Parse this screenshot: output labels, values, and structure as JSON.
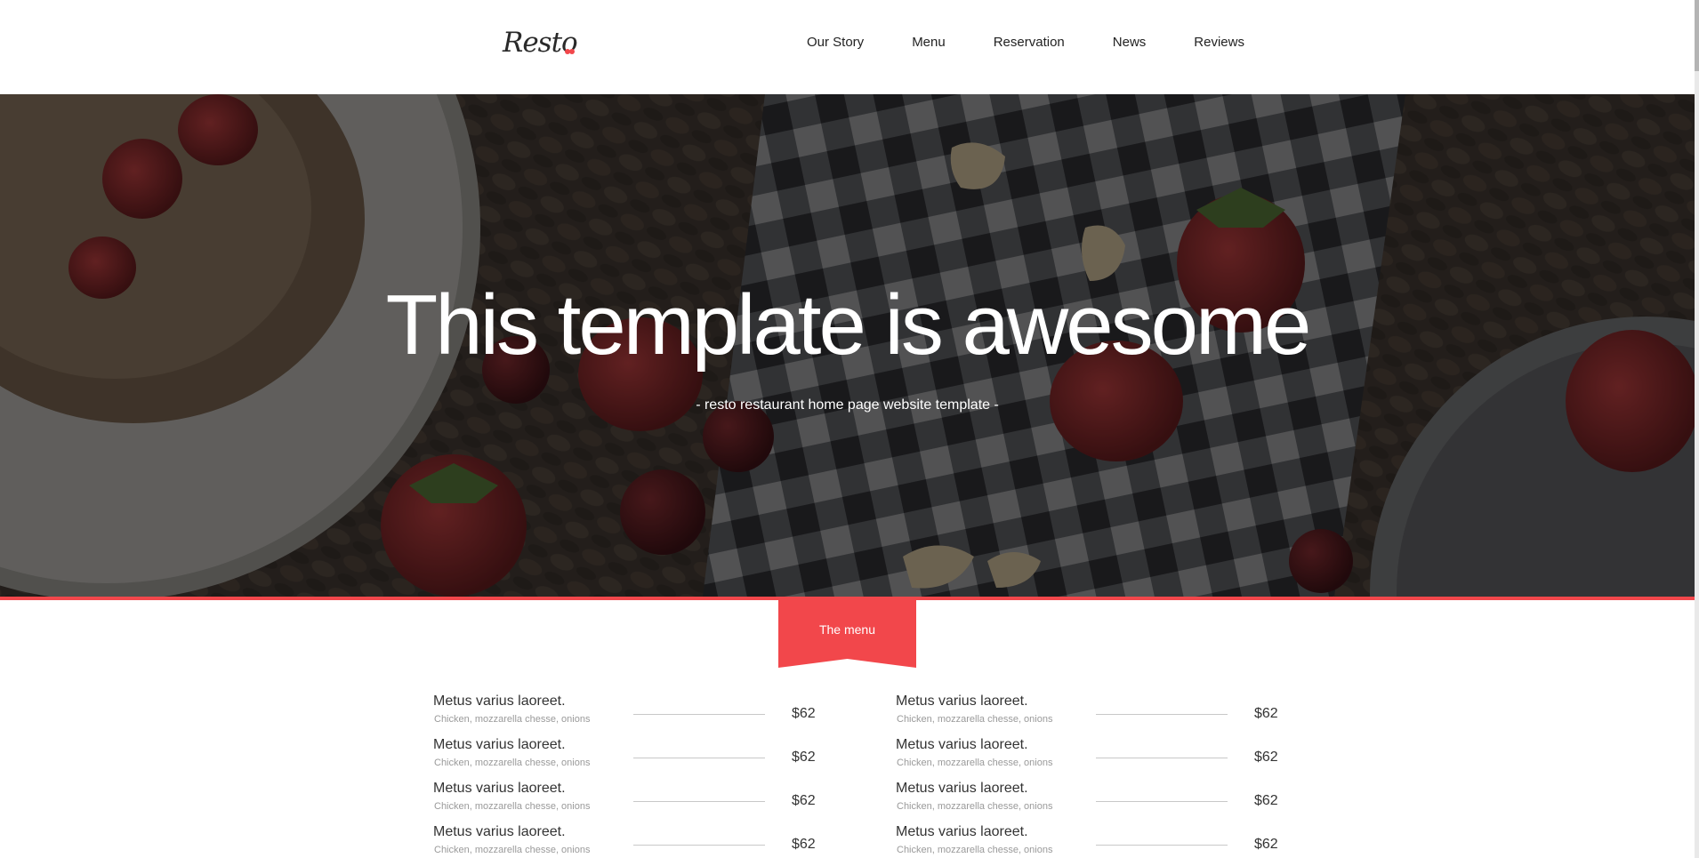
{
  "header": {
    "logo_text": "Resto",
    "nav": [
      "Our Story",
      "Menu",
      "Reservation",
      "News",
      "Reviews"
    ]
  },
  "hero": {
    "title": "This template is awesome",
    "subtitle": "- resto restaurant home page website template -"
  },
  "menu_section": {
    "ribbon_label": "The menu",
    "left": [
      {
        "name": "Metus varius laoreet.",
        "desc": "Chicken, mozzarella chesse, onions",
        "price": "$62"
      },
      {
        "name": "Metus varius laoreet.",
        "desc": "Chicken, mozzarella chesse, onions",
        "price": "$62"
      },
      {
        "name": "Metus varius laoreet.",
        "desc": "Chicken, mozzarella chesse, onions",
        "price": "$62"
      },
      {
        "name": "Metus varius laoreet.",
        "desc": "Chicken, mozzarella chesse, onions",
        "price": "$62"
      }
    ],
    "right": [
      {
        "name": "Metus varius laoreet.",
        "desc": "Chicken, mozzarella chesse, onions",
        "price": "$62"
      },
      {
        "name": "Metus varius laoreet.",
        "desc": "Chicken, mozzarella chesse, onions",
        "price": "$62"
      },
      {
        "name": "Metus varius laoreet.",
        "desc": "Chicken, mozzarella chesse, onions",
        "price": "$62"
      },
      {
        "name": "Metus varius laoreet.",
        "desc": "Chicken, mozzarella chesse, onions",
        "price": "$62"
      }
    ]
  },
  "colors": {
    "accent": "#f2474b",
    "text": "#333333",
    "muted": "#9a9a9a"
  }
}
